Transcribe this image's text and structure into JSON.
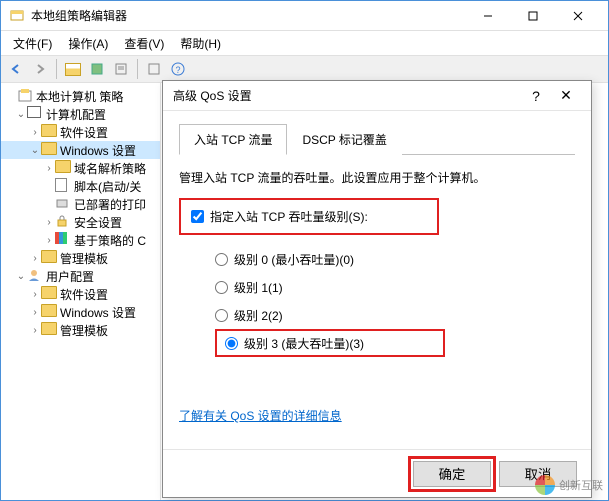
{
  "window": {
    "title": "本地组策略编辑器"
  },
  "menu": {
    "file": "文件(F)",
    "action": "操作(A)",
    "view": "查看(V)",
    "help": "帮助(H)"
  },
  "tree": {
    "root": "本地计算机 策略",
    "computer_config": "计算机配置",
    "software_settings": "软件设置",
    "windows_settings": "Windows 设置",
    "dns_policy": "域名解析策略",
    "scripts": "脚本(启动/关",
    "deployed_printers": "已部署的打印",
    "security_settings": "安全设置",
    "qos_policy": "基于策略的 C",
    "admin_templates": "管理模板",
    "user_config": "用户配置",
    "user_software": "软件设置",
    "user_windows": "Windows 设置",
    "user_admin_templates": "管理模板"
  },
  "dialog": {
    "title": "高级 QoS 设置",
    "tabs": {
      "inbound": "入站 TCP 流量",
      "dscp": "DSCP 标记覆盖"
    },
    "description": "管理入站 TCP 流量的吞吐量。此设置应用于整个计算机。",
    "checkbox_label": "指定入站 TCP 吞吐量级别(S):",
    "radios": {
      "level0": "级别 0 (最小吞吐量)(0)",
      "level1": "级别 1(1)",
      "level2": "级别 2(2)",
      "level3": "级别 3 (最大吞吐量)(3)"
    },
    "link": "了解有关 QoS 设置的详细信息",
    "ok": "确定",
    "cancel": "取消"
  },
  "watermark": "创新互联"
}
